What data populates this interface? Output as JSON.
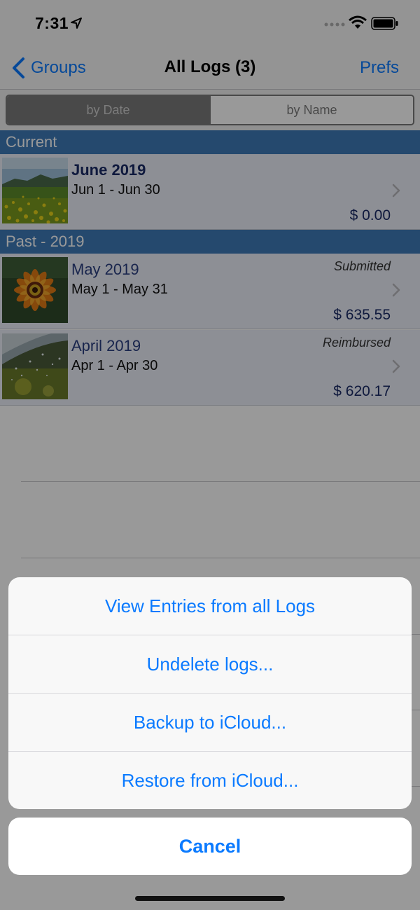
{
  "status_bar": {
    "time": "7:31"
  },
  "nav": {
    "back_label": "Groups",
    "title": "All Logs (3)",
    "prefs_label": "Prefs"
  },
  "segments": {
    "by_date": "by Date",
    "by_name": "by Name",
    "selected": "by Date"
  },
  "sections": {
    "current": {
      "title": "Current",
      "logs": [
        {
          "title": "June 2019",
          "range": "Jun 1 - Jun 30",
          "status": "",
          "amount": "$ 0.00",
          "thumbnail": "meadow-photo"
        }
      ]
    },
    "past": {
      "title": "Past - 2019",
      "logs": [
        {
          "title": "May 2019",
          "range": "May 1 - May 31",
          "status": "Submitted",
          "amount": "$ 635.55",
          "thumbnail": "flower-photo"
        },
        {
          "title": "April 2019",
          "range": "Apr 1 - Apr 30",
          "status": "Reimbursed",
          "amount": "$ 620.17",
          "thumbnail": "umbrella-rain-photo"
        }
      ]
    }
  },
  "action_sheet": {
    "items": [
      "View Entries from all Logs",
      "Undelete logs...",
      "Backup to iCloud...",
      "Restore from iCloud..."
    ],
    "cancel": "Cancel"
  },
  "colors": {
    "accent": "#0a7aff",
    "section_header": "#3f7ab8",
    "row_background": "#ebeef8",
    "title_text": "#1a2b66"
  }
}
